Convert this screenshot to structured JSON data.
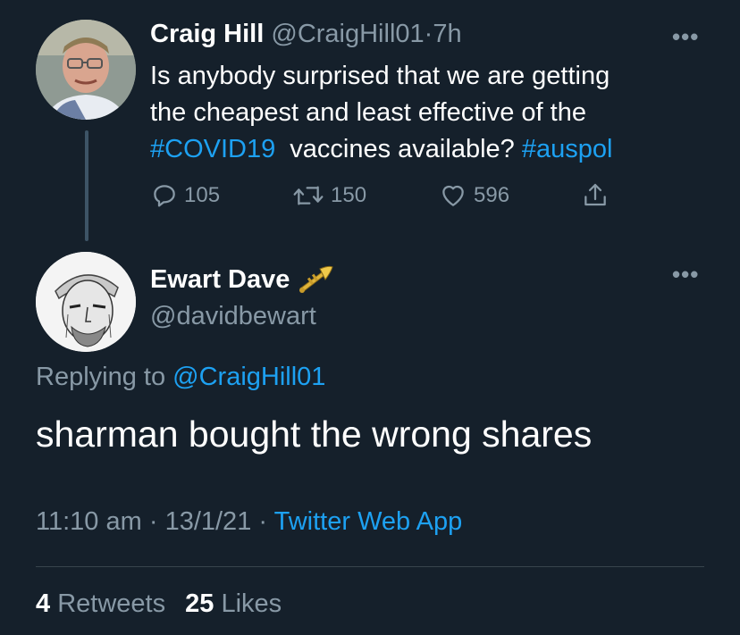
{
  "parent_tweet": {
    "display_name": "Craig Hill",
    "handle": "@CraigHill01",
    "separator": "·",
    "time": "7h",
    "text_line1": "Is anybody surprised that we are getting",
    "text_line2": "the cheapest and least effective of the",
    "hashtag1": "#COVID19",
    "text_mid": " vaccines available?",
    "hashtag2": "#auspol",
    "replies": "105",
    "retweets": "150",
    "likes": "596",
    "more_label": "•••"
  },
  "reply_tweet": {
    "display_name": "Ewart Dave",
    "handle": "@davidbewart",
    "replying_to_label": "Replying to",
    "replying_to_handle": "@CraigHill01",
    "text": "sharman bought the wrong shares",
    "time": "11:10 am",
    "separator1": "·",
    "date": "13/1/21",
    "separator2": "·",
    "source": "Twitter Web App",
    "more_label": "•••"
  },
  "stats": {
    "retweets_count": "4",
    "retweets_label": "Retweets",
    "likes_count": "25",
    "likes_label": "Likes"
  },
  "colors": {
    "background": "#15202b",
    "link": "#1da1f2",
    "muted": "#8899a6",
    "divider": "#38444d"
  },
  "icons": {
    "reply": "reply-icon",
    "retweet": "retweet-icon",
    "like": "heart-icon",
    "share": "share-icon",
    "emoji": "trumpet-icon"
  }
}
